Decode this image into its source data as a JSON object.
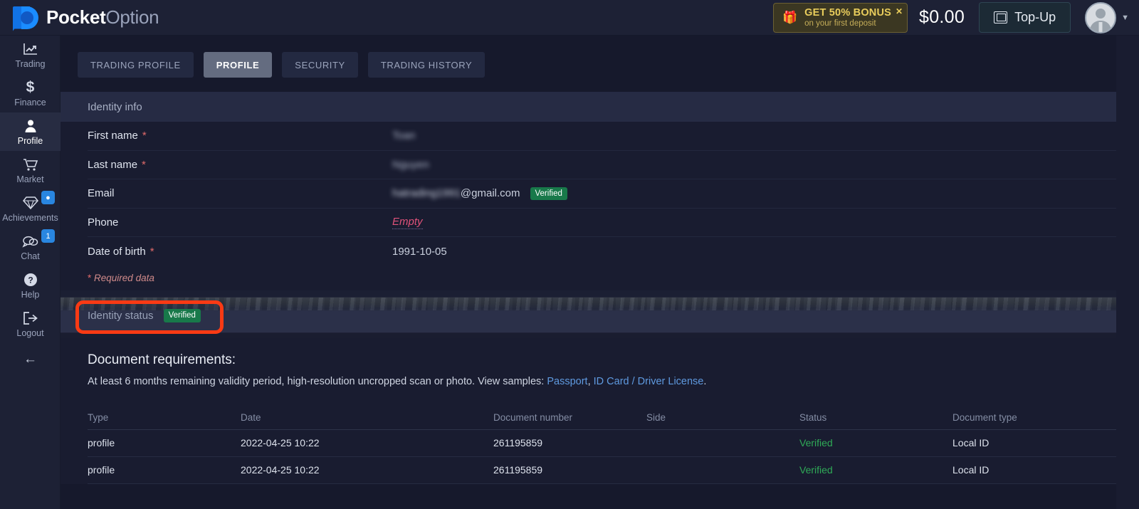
{
  "brand": {
    "name_bold": "Pocket",
    "name_light": "Option",
    "logo_icon": "pocket-option-logo"
  },
  "header": {
    "bonus": {
      "icon": "gift-icon",
      "title": "GET 50% BONUS",
      "subtitle": "on your first deposit",
      "close_icon": "close-icon"
    },
    "balance": "$0.00",
    "topup_label": "Top-Up",
    "topup_icon": "deposit-icon",
    "avatar_icon": "user-avatar",
    "caret_icon": "chevron-down-icon",
    "accent_gold": "#e9cd5c"
  },
  "sidebar": {
    "items": [
      {
        "label": "Trading",
        "icon": "chart-line-icon",
        "badge": "",
        "active": false
      },
      {
        "label": "Finance",
        "icon": "dollar-icon",
        "badge": "",
        "active": false
      },
      {
        "label": "Profile",
        "icon": "person-icon",
        "badge": "",
        "active": true
      },
      {
        "label": "Market",
        "icon": "cart-icon",
        "badge": "",
        "active": false
      },
      {
        "label": "Achievements",
        "icon": "diamond-icon",
        "badge": "●",
        "active": false
      },
      {
        "label": "Chat",
        "icon": "chat-bubble-icon",
        "badge": "1",
        "active": false
      },
      {
        "label": "Help",
        "icon": "question-circle-icon",
        "badge": "",
        "active": false
      },
      {
        "label": "Logout",
        "icon": "logout-icon",
        "badge": "",
        "active": false
      }
    ],
    "collapse_icon": "arrow-left-icon",
    "badge_color": "#2986e0"
  },
  "tabs": [
    {
      "label": "TRADING PROFILE",
      "active": false
    },
    {
      "label": "PROFILE",
      "active": true
    },
    {
      "label": "SECURITY",
      "active": false
    },
    {
      "label": "TRADING HISTORY",
      "active": false
    }
  ],
  "identity_info": {
    "panel_title": "Identity info",
    "fields": [
      {
        "label": "First name",
        "required": true,
        "value": "Toan",
        "blurred": true,
        "badge": ""
      },
      {
        "label": "Last name",
        "required": true,
        "value": "Nguyen",
        "blurred": true,
        "badge": ""
      },
      {
        "label": "Email",
        "required": false,
        "value_blurred": "hatrading1991",
        "value_plain": "@gmail.com",
        "badge": "Verified"
      },
      {
        "label": "Phone",
        "required": false,
        "value": "Empty",
        "empty": true,
        "badge": ""
      },
      {
        "label": "Date of birth",
        "required": true,
        "value": "1991-10-05",
        "blurred": false,
        "badge": ""
      }
    ],
    "required_note": "Required data",
    "required_star": "*"
  },
  "identity_status": {
    "label": "Identity status",
    "badge": "Verified",
    "badge_color": "#18794a",
    "highlight_color": "#fa3a14"
  },
  "documents": {
    "title": "Document requirements:",
    "description_pre": "At least 6 months remaining validity period, high-resolution uncropped scan or photo. View samples: ",
    "link_passport": "Passport",
    "separator": ", ",
    "link_idcard": "ID Card / Driver License",
    "description_post": ".",
    "link_color": "#5f9ae0",
    "columns": [
      "Type",
      "Date",
      "Document number",
      "Side",
      "Status",
      "Document type"
    ],
    "rows": [
      {
        "type": "profile",
        "date": "2022-04-25 10:22",
        "number": "261195859",
        "side": "",
        "status": "Verified",
        "doc_type": "Local ID"
      },
      {
        "type": "profile",
        "date": "2022-04-25 10:22",
        "number": "261195859",
        "side": "",
        "status": "Verified",
        "doc_type": "Local ID"
      }
    ],
    "status_ok_color": "#2faa57"
  }
}
